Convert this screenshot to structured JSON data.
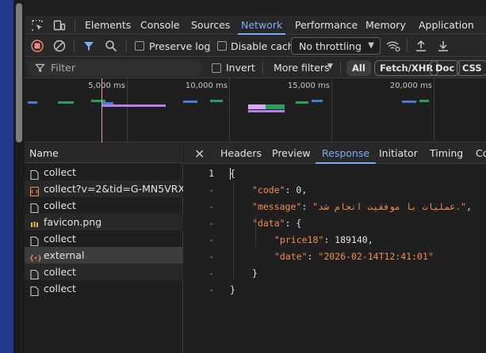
{
  "tabs": [
    "Elements",
    "Console",
    "Sources",
    "Network",
    "Performance",
    "Memory",
    "Application"
  ],
  "toolbar": {
    "preserve_log": "Preserve log",
    "disable_cache": "Disable cache",
    "throttle_value": "No throttling"
  },
  "filter": {
    "placeholder": "Filter",
    "invert": "Invert",
    "more_filters": "More filters",
    "type_pills": [
      "All",
      "Fetch/XHR",
      "Doc",
      "CSS"
    ]
  },
  "timeline": {
    "ticks": [
      "5,000 ms",
      "10,000 ms",
      "15,000 ms",
      "20,000 ms"
    ]
  },
  "requests": {
    "header": "Name",
    "items": [
      {
        "name": "collect",
        "icon": "document-icon"
      },
      {
        "name": "collect?v=2&tid=G-MN5VRX…",
        "icon": "script-icon"
      },
      {
        "name": "collect",
        "icon": "document-icon"
      },
      {
        "name": "favicon.png",
        "icon": "image-icon"
      },
      {
        "name": "collect",
        "icon": "document-icon"
      },
      {
        "name": "external",
        "icon": "xhr-icon"
      },
      {
        "name": "collect",
        "icon": "document-icon"
      },
      {
        "name": "collect",
        "icon": "document-icon"
      }
    ]
  },
  "detail": {
    "tabs": [
      "Headers",
      "Preview",
      "Response",
      "Initiator",
      "Timing",
      "Co"
    ],
    "active_tab": "Response",
    "line_numbers": [
      "1",
      "-",
      "-",
      "-",
      "-",
      "-",
      "-",
      "-"
    ],
    "response": {
      "open": "{",
      "code_key": "\"code\"",
      "code_val": "0",
      "message_key": "\"message\"",
      "message_val": "\"عملیات با موفقیت انجام شد.\"",
      "data_key": "\"data\"",
      "price_key": "\"price18\"",
      "price_val": "189140",
      "date_key": "\"date\"",
      "date_val": "\"2026-02-14T12:41:01\"",
      "close_inner": "}",
      "close": "}"
    }
  },
  "colors": {
    "accent": "#7cacf8",
    "record_red": "#f28b82",
    "json_string": "#f28b54",
    "taskbar_blue": "#223a8c"
  }
}
